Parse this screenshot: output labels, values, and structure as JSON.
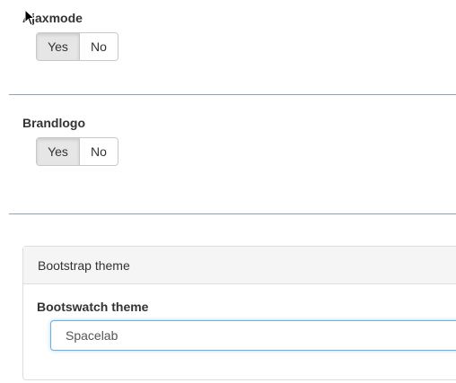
{
  "ajaxmode": {
    "label": "Ajaxmode",
    "yes_label": "Yes",
    "no_label": "No",
    "selected": "Yes"
  },
  "brandlogo": {
    "label": "Brandlogo",
    "yes_label": "Yes",
    "no_label": "No",
    "selected": "Yes"
  },
  "bootstrap_panel": {
    "heading": "Bootstrap theme",
    "bootswatch_label": "Bootswatch theme",
    "bootswatch_value": "Spacelab"
  },
  "colors": {
    "divider": "#8fa3b5",
    "focus_border": "#66afe9",
    "active_toggle_bg": "#e6e6e6"
  },
  "icons": {
    "cursor": "mouse-pointer-icon"
  }
}
